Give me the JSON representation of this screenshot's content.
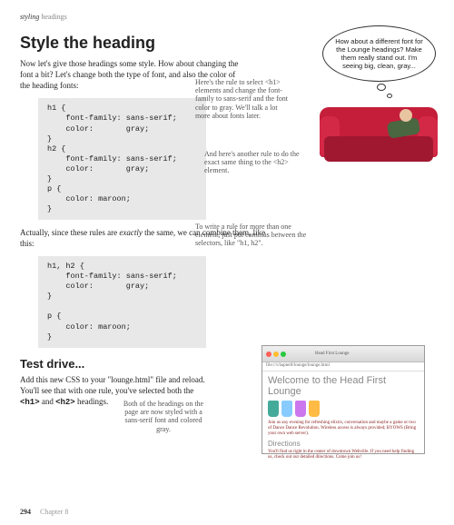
{
  "running_head": {
    "em": "styling",
    "rest": "headings"
  },
  "title": "Style the heading",
  "intro": "Now let's give those headings some style. How about changing the font a bit? Let's change both the type of font, and also the color of the heading fonts:",
  "code1": "h1 {\n    font-family: sans-serif;\n    color:       gray;\n}\nh2 {\n    font-family: sans-serif;\n    color:       gray;\n}\np {\n    color: maroon;\n}",
  "body2_a": "Actually, since these rules are ",
  "body2_em": "exactly",
  "body2_b": " the same, we can combine them, like this:",
  "code2": "h1, h2 {\n    font-family: sans-serif;\n    color:       gray;\n}\n\np {\n    color: maroon;\n}",
  "section2": "Test drive...",
  "testdrive_a": "Add this new CSS to your \"lounge.html\" file and reload. You'll see that with one rule, you've selected both the ",
  "testdrive_b1": "<h1>",
  "testdrive_mid": " and ",
  "testdrive_b2": "<h2>",
  "testdrive_c": " headings.",
  "bubble": "How about a different font for the Lounge headings? Make them really stand out. I'm seeing big, clean, gray...",
  "note1": "Here's the rule to select <h1> elements and change the font-family to sans-serif and the font color to gray. We'll talk a lot more about fonts later.",
  "note2": "And here's another rule to do the exact same thing to the <h2> element.",
  "note3": "To write a rule for more than one element, just put commas between the selectors, like \"h1, h2\".",
  "note4": "Both of the headings on the page are now styled with a sans-serif font and colored gray.",
  "browser": {
    "title": "Head First Lounge",
    "url": "file:///chapter8/lounge/lounge.html",
    "h1": "Welcome to the Head First Lounge",
    "p1": "Join us any evening for refreshing elixirs, conversation and maybe a game or two of Dance Dance Revolution. Wireless access is always provided; BYOWS (Bring your own web server).",
    "h2": "Directions",
    "p2": "You'll find us right in the center of downtown Webville. If you need help finding us, check out our detailed directions. Come join us!"
  },
  "footer": {
    "page": "294",
    "chapter": "Chapter 8"
  }
}
